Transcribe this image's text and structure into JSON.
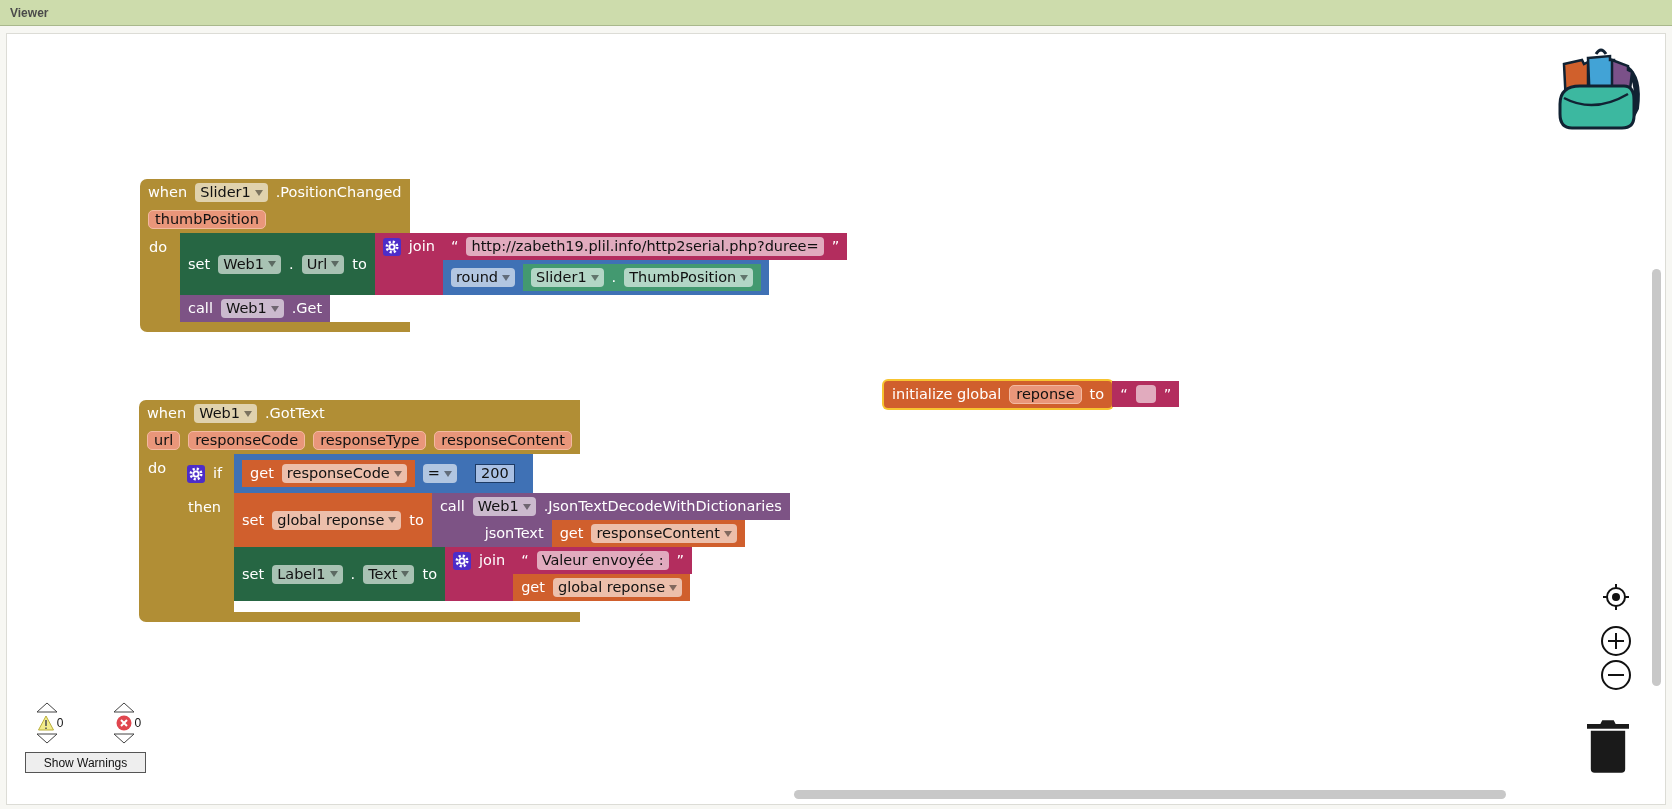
{
  "panel": {
    "title": "Viewer"
  },
  "blocks": [
    {
      "kind": "event",
      "color": "#b18e35",
      "selected": false,
      "rows": [
        {
          "tokens": [
            {
              "kind": "text",
              "text": "when"
            },
            {
              "kind": "dropdown",
              "text": "Slider1"
            },
            {
              "kind": "text",
              "text": ".PositionChanged"
            }
          ]
        },
        {
          "tokens": [
            {
              "kind": "param",
              "text": "thumbPosition"
            }
          ]
        }
      ],
      "sections": [
        {
          "tokens": [
            {
              "kind": "text",
              "text": "do"
            }
          ],
          "statements": [
            {
              "kind": "statement",
              "color": "#266643",
              "rows": [
                {
                  "tokens": [
                    {
                      "kind": "text",
                      "text": "set"
                    },
                    {
                      "kind": "dropdown",
                      "text": "Web1"
                    },
                    {
                      "kind": "text",
                      "text": "."
                    },
                    {
                      "kind": "dropdown",
                      "text": "Url"
                    },
                    {
                      "kind": "text",
                      "text": "to"
                    }
                  ],
                  "input": {
                    "kind": "value",
                    "color": "#b32d5e",
                    "rows": [
                      {
                        "tokens": [
                          {
                            "kind": "gear"
                          },
                          {
                            "kind": "text",
                            "text": "join"
                          }
                        ],
                        "input": {
                          "kind": "value",
                          "color": "#b32d5e",
                          "rows": [
                            {
                              "tokens": [
                                {
                                  "kind": "text",
                                  "text": "“"
                                },
                                {
                                  "kind": "field",
                                  "text": "http://zabeth19.plil.info/http2serial.php?duree="
                                },
                                {
                                  "kind": "text",
                                  "text": "”"
                                }
                              ]
                            }
                          ]
                        }
                      },
                      {
                        "input": {
                          "kind": "value",
                          "color": "#3f71b5",
                          "rows": [
                            {
                              "tokens": [
                                {
                                  "kind": "dropdown",
                                  "text": "round"
                                },
                                {
                                  "kind": "block",
                                  "block": {
                                    "kind": "value",
                                    "color": "#439970",
                                    "rows": [
                                      {
                                        "tokens": [
                                          {
                                            "kind": "dropdown",
                                            "text": "Slider1"
                                          },
                                          {
                                            "kind": "text",
                                            "text": "."
                                          },
                                          {
                                            "kind": "dropdown",
                                            "text": "ThumbPosition"
                                          }
                                        ]
                                      }
                                    ]
                                  }
                                }
                              ]
                            }
                          ]
                        }
                      }
                    ]
                  }
                }
              ]
            },
            {
              "kind": "statement",
              "color": "#7d5385",
              "rows": [
                {
                  "tokens": [
                    {
                      "kind": "text",
                      "text": "call"
                    },
                    {
                      "kind": "dropdown",
                      "text": "Web1"
                    },
                    {
                      "kind": "text",
                      "text": ".Get"
                    }
                  ]
                }
              ]
            }
          ]
        }
      ]
    },
    {
      "kind": "event",
      "color": "#b18e35",
      "selected": false,
      "rows": [
        {
          "tokens": [
            {
              "kind": "text",
              "text": "when"
            },
            {
              "kind": "dropdown",
              "text": "Web1"
            },
            {
              "kind": "text",
              "text": ".GotText"
            }
          ]
        },
        {
          "tokens": [
            {
              "kind": "param",
              "text": "url"
            },
            {
              "kind": "param",
              "text": "responseCode"
            },
            {
              "kind": "param",
              "text": "responseType"
            },
            {
              "kind": "param",
              "text": "responseContent"
            }
          ]
        }
      ],
      "sections": [
        {
          "tokens": [
            {
              "kind": "text",
              "text": "do"
            }
          ],
          "statements": [
            {
              "kind": "control",
              "color": "#b18e35",
              "rows": [
                {
                  "tokens": [
                    {
                      "kind": "gear"
                    },
                    {
                      "kind": "text",
                      "text": "if"
                    }
                  ],
                  "input": {
                    "kind": "value",
                    "color": "#3f71b5",
                    "rows": [
                      {
                        "tokens": [
                          {
                            "kind": "block",
                            "block": {
                              "kind": "value",
                              "color": "#d05f2d",
                              "rows": [
                                {
                                  "tokens": [
                                    {
                                      "kind": "text",
                                      "text": "get"
                                    },
                                    {
                                      "kind": "dropdown",
                                      "text": "responseCode"
                                    }
                                  ]
                                }
                              ]
                            }
                          },
                          {
                            "kind": "dropdown",
                            "text": "="
                          },
                          {
                            "kind": "block",
                            "block": {
                              "kind": "value",
                              "color": "#3f71b5",
                              "rows": [
                                {
                                  "tokens": [
                                    {
                                      "kind": "number",
                                      "text": "200"
                                    }
                                  ]
                                }
                              ]
                            }
                          }
                        ]
                      }
                    ]
                  }
                }
              ],
              "sections": [
                {
                  "tokens": [
                    {
                      "kind": "text",
                      "text": "then"
                    }
                  ],
                  "statements": [
                    {
                      "kind": "statement",
                      "color": "#d05f2d",
                      "rows": [
                        {
                          "tokens": [
                            {
                              "kind": "text",
                              "text": "set"
                            },
                            {
                              "kind": "dropdown",
                              "text": "global reponse"
                            },
                            {
                              "kind": "text",
                              "text": "to"
                            }
                          ],
                          "input": {
                            "kind": "value",
                            "color": "#7d5385",
                            "rows": [
                              {
                                "tokens": [
                                  {
                                    "kind": "text",
                                    "text": "call"
                                  },
                                  {
                                    "kind": "dropdown",
                                    "text": "Web1"
                                  },
                                  {
                                    "kind": "text",
                                    "text": ".JsonTextDecodeWithDictionaries"
                                  }
                                ]
                              },
                              {
                                "tokens": [
                                  {
                                    "kind": "text",
                                    "text": "jsonText"
                                  }
                                ],
                                "input": {
                                  "kind": "value",
                                  "color": "#d05f2d",
                                  "rows": [
                                    {
                                      "tokens": [
                                        {
                                          "kind": "text",
                                          "text": "get"
                                        },
                                        {
                                          "kind": "dropdown",
                                          "text": "responseContent"
                                        }
                                      ]
                                    }
                                  ]
                                }
                              }
                            ]
                          }
                        }
                      ]
                    },
                    {
                      "kind": "statement",
                      "color": "#266643",
                      "rows": [
                        {
                          "tokens": [
                            {
                              "kind": "text",
                              "text": "set"
                            },
                            {
                              "kind": "dropdown",
                              "text": "Label1"
                            },
                            {
                              "kind": "text",
                              "text": "."
                            },
                            {
                              "kind": "dropdown",
                              "text": "Text"
                            },
                            {
                              "kind": "text",
                              "text": "to"
                            }
                          ],
                          "input": {
                            "kind": "value",
                            "color": "#b32d5e",
                            "rows": [
                              {
                                "tokens": [
                                  {
                                    "kind": "gear"
                                  },
                                  {
                                    "kind": "text",
                                    "text": "join"
                                  }
                                ],
                                "input": {
                                  "kind": "value",
                                  "color": "#b32d5e",
                                  "rows": [
                                    {
                                      "tokens": [
                                        {
                                          "kind": "text",
                                          "text": "“"
                                        },
                                        {
                                          "kind": "field",
                                          "text": "Valeur envoyée :"
                                        },
                                        {
                                          "kind": "text",
                                          "text": "”"
                                        }
                                      ]
                                    }
                                  ]
                                }
                              },
                              {
                                "input": {
                                  "kind": "value",
                                  "color": "#d05f2d",
                                  "rows": [
                                    {
                                      "tokens": [
                                        {
                                          "kind": "text",
                                          "text": "get"
                                        },
                                        {
                                          "kind": "dropdown",
                                          "text": "global reponse"
                                        }
                                      ]
                                    }
                                  ]
                                }
                              }
                            ]
                          }
                        }
                      ]
                    }
                  ]
                }
              ]
            }
          ]
        }
      ]
    },
    {
      "kind": "statement",
      "color": "#d05f2d",
      "selected": true,
      "rows": [
        {
          "tokens": [
            {
              "kind": "text",
              "text": "initialize global"
            },
            {
              "kind": "param",
              "text": "reponse"
            },
            {
              "kind": "text",
              "text": "to"
            }
          ],
          "input": {
            "kind": "value",
            "color": "#b32d5e",
            "rows": [
              {
                "tokens": [
                  {
                    "kind": "text",
                    "text": "“"
                  },
                  {
                    "kind": "field"
                  },
                  {
                    "kind": "text",
                    "text": "”"
                  }
                ]
              }
            ]
          }
        }
      ]
    }
  ],
  "warnings": {
    "warning_count": "0",
    "error_count": "0",
    "button": "Show Warnings"
  }
}
